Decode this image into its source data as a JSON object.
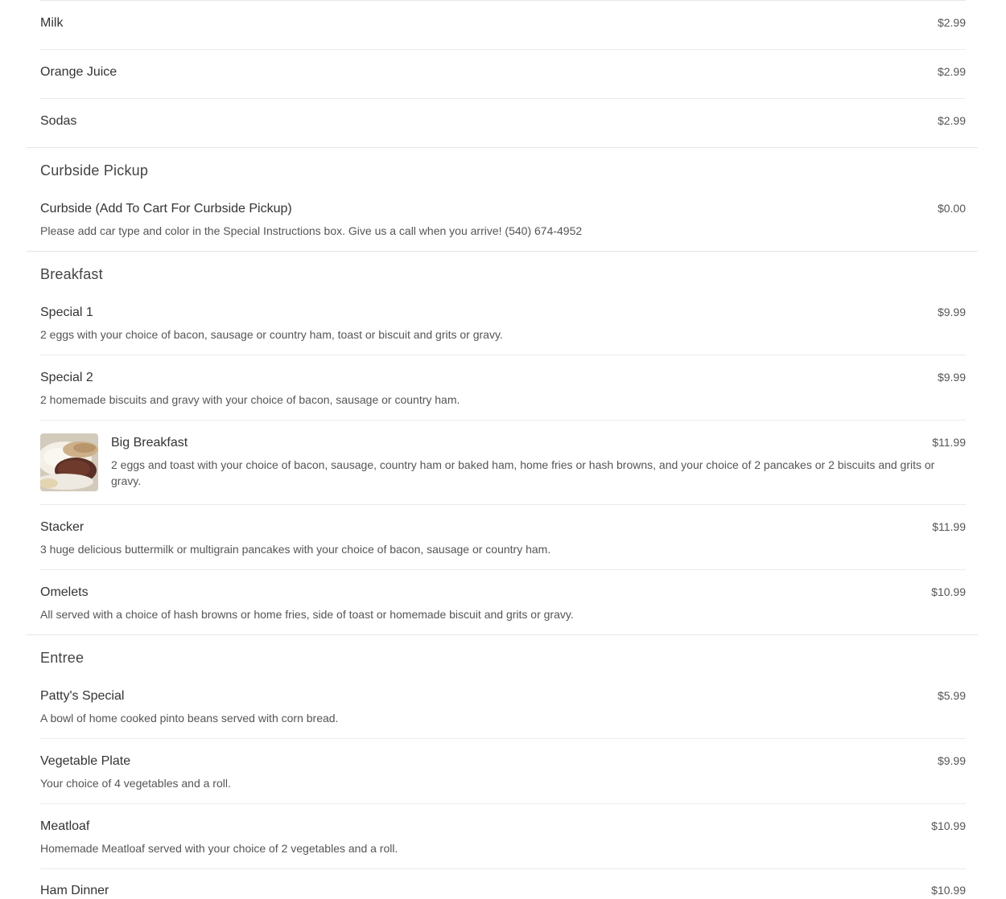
{
  "drinks": {
    "items": [
      {
        "name": "Milk",
        "price": "$2.99"
      },
      {
        "name": "Orange Juice",
        "price": "$2.99"
      },
      {
        "name": "Sodas",
        "price": "$2.99"
      }
    ]
  },
  "curbside": {
    "title": "Curbside Pickup",
    "items": [
      {
        "name": "Curbside (Add To Cart For Curbside Pickup)",
        "price": "$0.00",
        "desc": "Please add car type and color in the Special Instructions box. Give us a call when you arrive! (540) 674-4952"
      }
    ]
  },
  "breakfast": {
    "title": "Breakfast",
    "items": [
      {
        "name": "Special 1",
        "price": "$9.99",
        "desc": "2 eggs with your choice of bacon, sausage or country ham, toast or biscuit and grits or gravy."
      },
      {
        "name": "Special 2",
        "price": "$9.99",
        "desc": "2 homemade biscuits and gravy with your choice of bacon, sausage or country ham."
      },
      {
        "name": "Big Breakfast",
        "price": "$11.99",
        "desc": "2 eggs and toast with your choice of bacon, sausage, country ham or baked ham, home fries or hash browns, and your choice of 2 pancakes or 2 biscuits and grits or gravy."
      },
      {
        "name": "Stacker",
        "price": "$11.99",
        "desc": "3 huge delicious buttermilk or multigrain pancakes with your choice of bacon, sausage or country ham."
      },
      {
        "name": "Omelets",
        "price": "$10.99",
        "desc": "All served with a choice of hash browns or home fries, side of toast or homemade biscuit and grits or gravy."
      }
    ]
  },
  "entree": {
    "title": "Entree",
    "items": [
      {
        "name": "Patty's Special",
        "price": "$5.99",
        "desc": "A bowl of home cooked pinto beans served with corn bread."
      },
      {
        "name": "Vegetable Plate",
        "price": "$9.99",
        "desc": "Your choice of 4 vegetables and a roll."
      },
      {
        "name": "Meatloaf",
        "price": "$10.99",
        "desc": "Homemade Meatloaf served with your choice of 2 vegetables and a roll."
      },
      {
        "name": "Ham Dinner",
        "price": "$10.99"
      }
    ]
  }
}
